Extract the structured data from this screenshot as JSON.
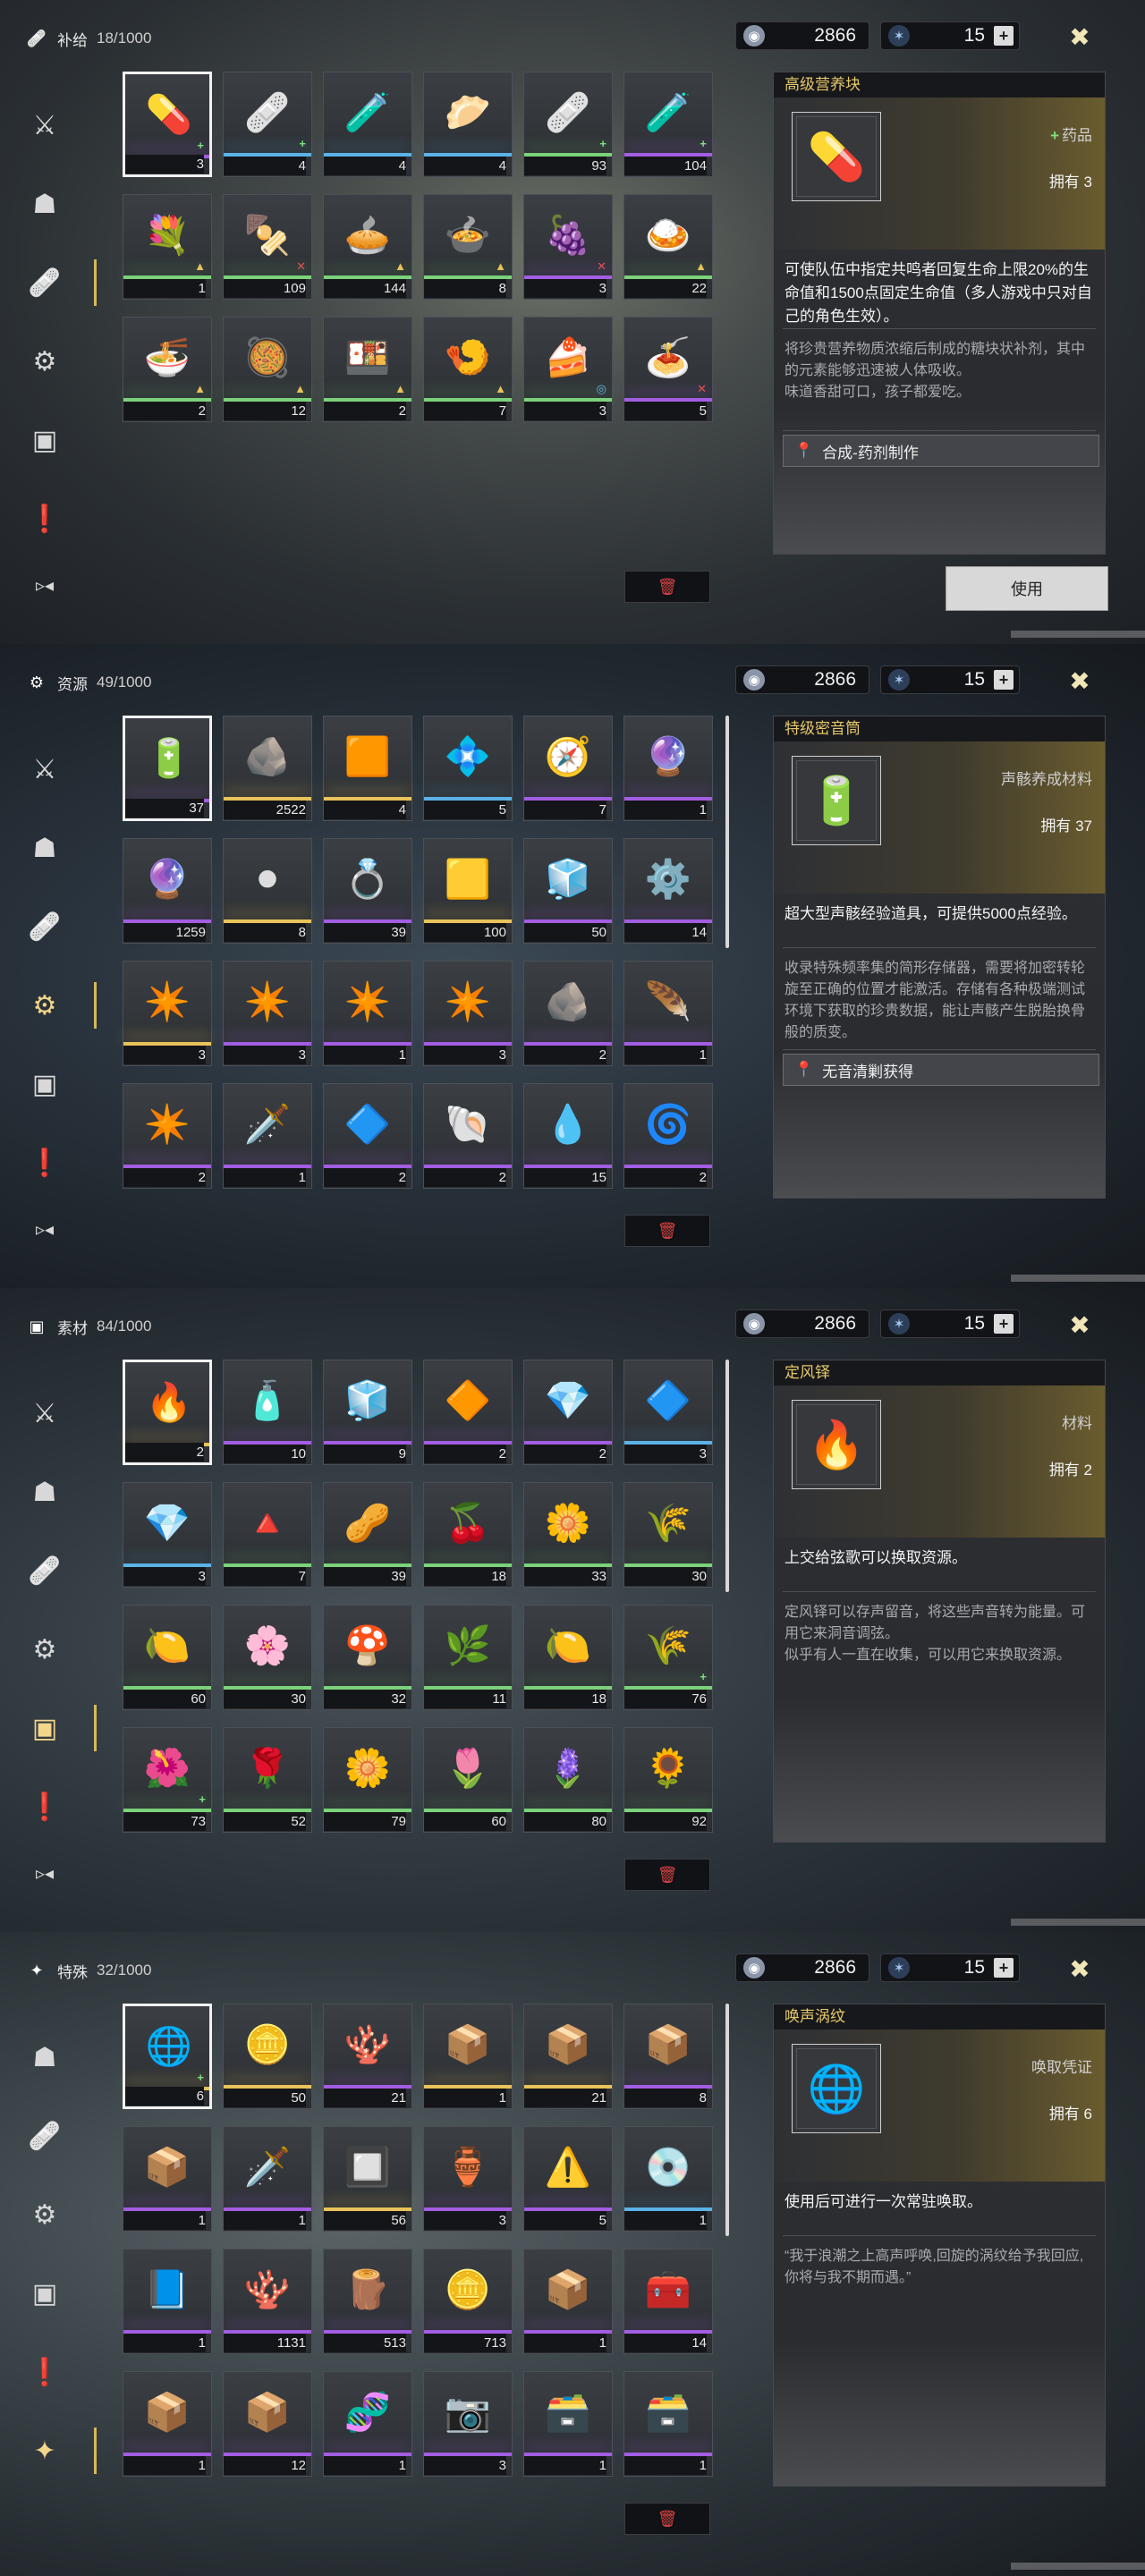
{
  "common": {
    "currency1": "2866",
    "currency2": "15",
    "currency1_icon": "coin-icon",
    "currency2_icon": "star-crystal-icon",
    "plus": "+",
    "close_icon": "close-icon",
    "trash_icon": "trash-icon",
    "use_label": "使用"
  },
  "panels": [
    {
      "category": "补给",
      "count": "18/1000",
      "icon": "bandage-icon",
      "active_nav": 2,
      "slots": [
        {
          "qty": "3",
          "q": "purple",
          "art": "💊",
          "badge": "+"
        },
        {
          "qty": "4",
          "q": "blue",
          "art": "🩹",
          "badge": "+"
        },
        {
          "qty": "4",
          "q": "blue",
          "art": "🧪"
        },
        {
          "qty": "4",
          "q": "blue",
          "art": "🥟"
        },
        {
          "qty": "93",
          "q": "green",
          "art": "🩹",
          "badge": "+"
        },
        {
          "qty": "104",
          "q": "purple",
          "art": "🧪",
          "badge": "+"
        },
        {
          "qty": "1",
          "q": "green",
          "art": "💐",
          "badge": "▲"
        },
        {
          "qty": "109",
          "q": "green",
          "art": "🍢",
          "badge": "✕"
        },
        {
          "qty": "144",
          "q": "green",
          "art": "🥧",
          "badge": "▲"
        },
        {
          "qty": "8",
          "q": "green",
          "art": "🍲",
          "badge": "▲"
        },
        {
          "qty": "3",
          "q": "purple",
          "art": "🍇",
          "badge": "✕"
        },
        {
          "qty": "22",
          "q": "green",
          "art": "🍛",
          "badge": "▲"
        },
        {
          "qty": "2",
          "q": "green",
          "art": "🍜",
          "badge": "▲"
        },
        {
          "qty": "12",
          "q": "green",
          "art": "🥘",
          "badge": "▲"
        },
        {
          "qty": "2",
          "q": "green",
          "art": "🍱",
          "badge": "▲"
        },
        {
          "qty": "7",
          "q": "green",
          "art": "🍤",
          "badge": "▲"
        },
        {
          "qty": "3",
          "q": "green",
          "art": "🍰",
          "badge": "◎"
        },
        {
          "qty": "5",
          "q": "purple",
          "art": "🍝",
          "badge": "✕"
        }
      ],
      "detail": {
        "title": "高级营养块",
        "type": "药品",
        "type_plus": true,
        "owned": "拥有 3",
        "thumb": "💊",
        "summary": "可使队伍中指定共鸣者回复生命上限20%的生命值和1500点固定生命值（多人游戏中只对自己的角色生效）。",
        "flavor": "将珍贵营养物质浓缩后制成的糖块状补剂，其中的元素能够迅速被人体吸收。\n味道香甜可口，孩子都爱吃。",
        "source": "合成-药剂制作",
        "use": true
      }
    },
    {
      "category": "资源",
      "count": "49/1000",
      "icon": "gear-icon",
      "active_nav": 3,
      "slots": [
        {
          "qty": "37",
          "q": "purple",
          "art": "🔋"
        },
        {
          "qty": "2522",
          "q": "gold",
          "art": "🪨"
        },
        {
          "qty": "4",
          "q": "gold",
          "art": "🟧"
        },
        {
          "qty": "5",
          "q": "blue",
          "art": "💠"
        },
        {
          "qty": "7",
          "q": "purple",
          "art": "🧭"
        },
        {
          "qty": "1",
          "q": "purple",
          "art": "🔮"
        },
        {
          "qty": "1259",
          "q": "purple",
          "art": "🔮"
        },
        {
          "qty": "8",
          "q": "gold",
          "art": "⚫"
        },
        {
          "qty": "39",
          "q": "purple",
          "art": "💍"
        },
        {
          "qty": "100",
          "q": "gold",
          "art": "🟨"
        },
        {
          "qty": "50",
          "q": "purple",
          "art": "🧊"
        },
        {
          "qty": "14",
          "q": "purple",
          "art": "⚙️"
        },
        {
          "qty": "3",
          "q": "gold",
          "art": "✴️"
        },
        {
          "qty": "3",
          "q": "purple",
          "art": "✴️"
        },
        {
          "qty": "1",
          "q": "purple",
          "art": "✴️"
        },
        {
          "qty": "3",
          "q": "purple",
          "art": "✴️"
        },
        {
          "qty": "2",
          "q": "purple",
          "art": "🪨"
        },
        {
          "qty": "1",
          "q": "purple",
          "art": "🪶"
        },
        {
          "qty": "2",
          "q": "purple",
          "art": "✴️"
        },
        {
          "qty": "1",
          "q": "purple",
          "art": "🗡️"
        },
        {
          "qty": "2",
          "q": "purple",
          "art": "🔷"
        },
        {
          "qty": "2",
          "q": "purple",
          "art": "🐚"
        },
        {
          "qty": "15",
          "q": "purple",
          "art": "💧"
        },
        {
          "qty": "2",
          "q": "purple",
          "art": "🌀"
        }
      ],
      "detail": {
        "title": "特级密音筒",
        "type": "声骸养成材料",
        "type_plus": false,
        "owned": "拥有 37",
        "thumb": "🔋",
        "summary": "超大型声骸经验道具，可提供5000点经验。",
        "flavor": "收录特殊频率集的简形存储器，需要将加密转轮旋至正确的位置才能激活。存储有各种极端测试环境下获取的珍贵数据，能让声骸产生脱胎换骨般的质变。",
        "source": "无音清剿获得",
        "use": false
      }
    },
    {
      "category": "素材",
      "count": "84/1000",
      "icon": "box-icon",
      "active_nav": 4,
      "slots": [
        {
          "qty": "2",
          "q": "gold",
          "art": "🔥"
        },
        {
          "qty": "10",
          "q": "purple",
          "art": "🧴"
        },
        {
          "qty": "9",
          "q": "purple",
          "art": "🧊"
        },
        {
          "qty": "2",
          "q": "purple",
          "art": "🔶"
        },
        {
          "qty": "2",
          "q": "purple",
          "art": "💎"
        },
        {
          "qty": "3",
          "q": "blue",
          "art": "🔷"
        },
        {
          "qty": "3",
          "q": "blue",
          "art": "💎"
        },
        {
          "qty": "7",
          "q": "green",
          "art": "🔺"
        },
        {
          "qty": "39",
          "q": "green",
          "art": "🥜"
        },
        {
          "qty": "18",
          "q": "green",
          "art": "🍒"
        },
        {
          "qty": "33",
          "q": "green",
          "art": "🌼"
        },
        {
          "qty": "30",
          "q": "green",
          "art": "🌾"
        },
        {
          "qty": "60",
          "q": "green",
          "art": "🍋"
        },
        {
          "qty": "30",
          "q": "green",
          "art": "🌸"
        },
        {
          "qty": "32",
          "q": "green",
          "art": "🍄"
        },
        {
          "qty": "11",
          "q": "green",
          "art": "🌿"
        },
        {
          "qty": "18",
          "q": "green",
          "art": "🍋"
        },
        {
          "qty": "76",
          "q": "green",
          "art": "🌾",
          "badge": "+"
        },
        {
          "qty": "73",
          "q": "green",
          "art": "🌺",
          "badge": "+"
        },
        {
          "qty": "52",
          "q": "green",
          "art": "🌹"
        },
        {
          "qty": "79",
          "q": "green",
          "art": "🌼"
        },
        {
          "qty": "60",
          "q": "green",
          "art": "🌷"
        },
        {
          "qty": "80",
          "q": "green",
          "art": "🪻"
        },
        {
          "qty": "92",
          "q": "green",
          "art": "🌻"
        }
      ],
      "detail": {
        "title": "定风铎",
        "type": "材料",
        "type_plus": false,
        "owned": "拥有 2",
        "thumb": "🔥",
        "summary": "上交给弦歌可以换取资源。",
        "flavor": "定风铎可以存声留音，将这些声音转为能量。可用它来洞音调弦。\n似乎有人一直在收集，可以用它来换取资源。",
        "source": "",
        "use": false
      }
    },
    {
      "category": "特殊",
      "count": "32/1000",
      "icon": "star-icon",
      "active_nav": 5,
      "slots": [
        {
          "qty": "6",
          "q": "gold",
          "art": "🌐",
          "badge": "+"
        },
        {
          "qty": "50",
          "q": "gold",
          "art": "🪙"
        },
        {
          "qty": "21",
          "q": "purple",
          "art": "🪸"
        },
        {
          "qty": "1",
          "q": "gold",
          "art": "📦"
        },
        {
          "qty": "21",
          "q": "gold",
          "art": "📦"
        },
        {
          "qty": "8",
          "q": "purple",
          "art": "📦"
        },
        {
          "qty": "1",
          "q": "purple",
          "art": "📦"
        },
        {
          "qty": "1",
          "q": "purple",
          "art": "🗡️"
        },
        {
          "qty": "56",
          "q": "gold",
          "art": "🔲"
        },
        {
          "qty": "3",
          "q": "purple",
          "art": "🏺"
        },
        {
          "qty": "5",
          "q": "purple",
          "art": "⚠️"
        },
        {
          "qty": "1",
          "q": "blue",
          "art": "💿"
        },
        {
          "qty": "1",
          "q": "purple",
          "art": "📘"
        },
        {
          "qty": "1131",
          "q": "purple",
          "art": "🪸"
        },
        {
          "qty": "513",
          "q": "purple",
          "art": "🪵"
        },
        {
          "qty": "713",
          "q": "purple",
          "art": "🪙"
        },
        {
          "qty": "1",
          "q": "purple",
          "art": "📦"
        },
        {
          "qty": "14",
          "q": "purple",
          "art": "🧰"
        },
        {
          "qty": "1",
          "q": "purple",
          "art": "📦"
        },
        {
          "qty": "12",
          "q": "purple",
          "art": "📦"
        },
        {
          "qty": "1",
          "q": "purple",
          "art": "🧬"
        },
        {
          "qty": "3",
          "q": "purple",
          "art": "📷"
        },
        {
          "qty": "1",
          "q": "purple",
          "art": "🗃️"
        },
        {
          "qty": "1",
          "q": "purple",
          "art": "🗃️"
        }
      ],
      "detail": {
        "title": "唤声涡纹",
        "type": "唤取凭证",
        "type_plus": false,
        "owned": "拥有 6",
        "thumb": "🌐",
        "summary": "使用后可进行一次常驻唤取。",
        "flavor": "“我于浪潮之上高声呼唤,回旋的涡纹给予我回应,你将与我不期而遇。”",
        "source": "",
        "use": false
      }
    }
  ],
  "nav_icons": [
    "swords-icon",
    "mask-icon",
    "bandage-icon",
    "gear-icon",
    "box-icon",
    "exclamation-icon",
    "play-icon",
    "star-icon"
  ]
}
